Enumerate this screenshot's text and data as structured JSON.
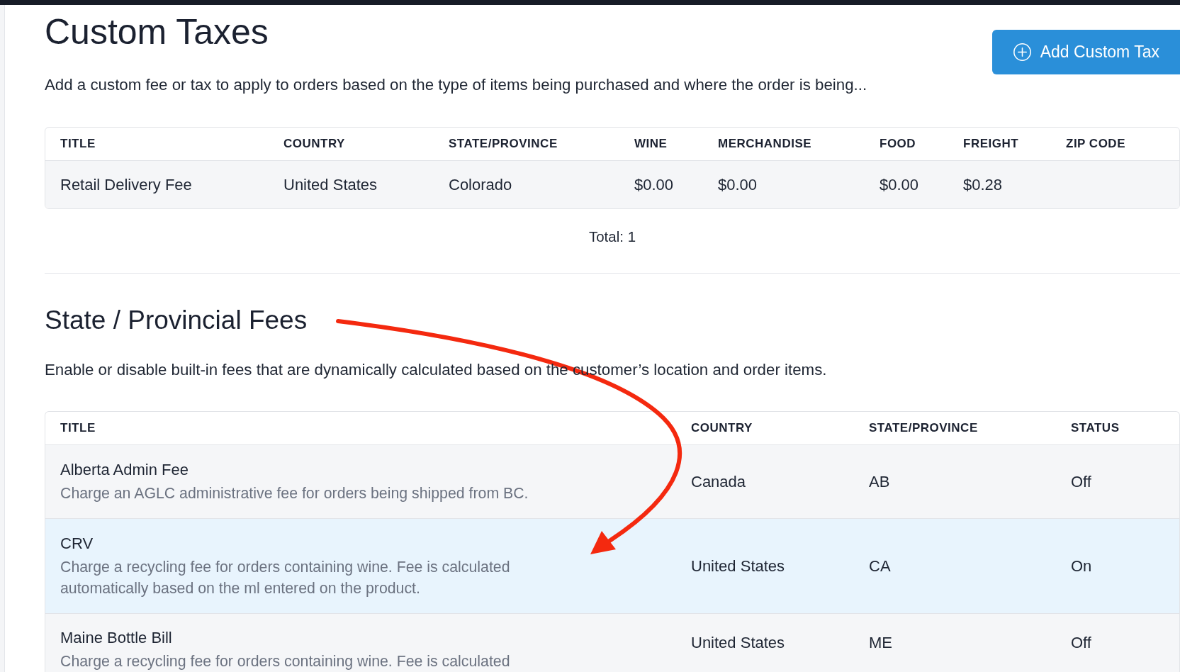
{
  "custom_taxes": {
    "title": "Custom Taxes",
    "add_button": {
      "label": "Add Custom Tax"
    },
    "description": "Add a custom fee or tax to apply to orders based on the type of items being purchased and where the order is being...",
    "table": {
      "columns": [
        "TITLE",
        "COUNTRY",
        "STATE/PROVINCE",
        "WINE",
        "MERCHANDISE",
        "FOOD",
        "FREIGHT",
        "ZIP CODE"
      ],
      "rows": [
        {
          "cells": [
            "Retail Delivery Fee",
            "United States",
            "Colorado",
            "$0.00",
            "$0.00",
            "$0.00",
            "$0.28"
          ]
        }
      ]
    },
    "total": "Total: 1"
  },
  "state_fees": {
    "title": "State / Provincial Fees",
    "description": "Enable or disable built-in fees that are dynamically calculated based on the customer’s location and order items.",
    "table": {
      "columns": [
        "TITLE",
        "COUNTRY",
        "STATE/PROVINCE",
        "STATUS"
      ],
      "rows": [
        {
          "title": "Alberta Admin Fee",
          "description": "Charge an AGLC administrative fee for orders being shipped from BC.",
          "country": "Canada",
          "state": "AB",
          "status": "Off",
          "selected": false
        },
        {
          "title": "CRV",
          "description": "Charge a recycling fee for orders containing wine. Fee is calculated automatically based on the ml entered on the product.",
          "country": "United States",
          "state": "CA",
          "status": "On",
          "selected": true
        },
        {
          "title": "Maine Bottle Bill",
          "description": "Charge a recycling fee for orders containing wine. Fee is calculated",
          "country": "United States",
          "state": "ME",
          "status": "Off",
          "selected": false
        }
      ]
    }
  },
  "annotations": [
    {
      "kind": "arrow"
    }
  ]
}
